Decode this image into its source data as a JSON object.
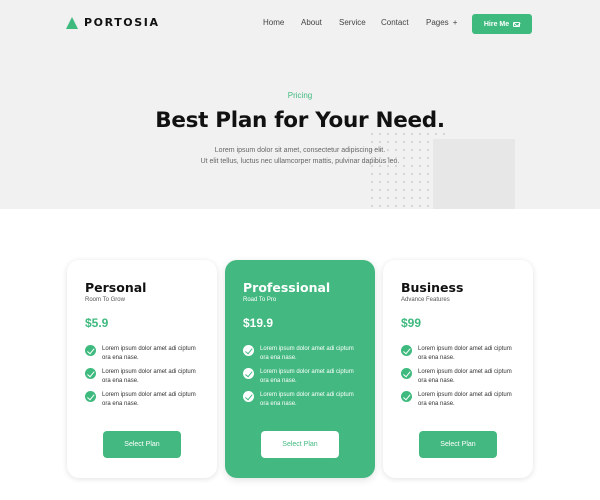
{
  "brand": {
    "name": "PORTOSIA",
    "logo_icon": "triangle-logo-icon",
    "accent": "#3fba7f"
  },
  "nav": {
    "items": [
      "Home",
      "About",
      "Service",
      "Contact",
      "Pages"
    ],
    "pages_suffix": "+",
    "cta_label": "Hire Me",
    "cta_icon": "mail-icon"
  },
  "hero": {
    "eyebrow": "Pricing",
    "title": "Best Plan for Your Need.",
    "subtitle_line1": "Lorem ipsum dolor sit amet, consectetur adipiscing elit.",
    "subtitle_line2": "Ut elit tellus, luctus nec ullamcorper mattis, pulvinar dapibus leo."
  },
  "plans": [
    {
      "name": "Personal",
      "tagline": "Room To Grow",
      "price": "$5.9",
      "featured": false,
      "features": [
        "Lorem ipsum dolor amet adi ciptum ora ena nase.",
        "Lorem ipsum dolor amet adi ciptum ora ena nase.",
        "Lorem ipsum dolor amet adi ciptum ora ena nase."
      ],
      "button_label": "Select Plan"
    },
    {
      "name": "Professional",
      "tagline": "Road To Pro",
      "price": "$19.9",
      "featured": true,
      "features": [
        "Lorem ipsum dolor amet adi ciptum ora ena nase.",
        "Lorem ipsum dolor amet adi ciptum ora ena nase.",
        "Lorem ipsum dolor amet adi ciptum ora ena nase."
      ],
      "button_label": "Select Plan"
    },
    {
      "name": "Business",
      "tagline": "Advance Features",
      "price": "$99",
      "featured": false,
      "features": [
        "Lorem ipsum dolor amet adi ciptum ora ena nase.",
        "Lorem ipsum dolor amet adi ciptum ora ena nase.",
        "Lorem ipsum dolor amet adi ciptum ora ena nase."
      ],
      "button_label": "Select Plan"
    }
  ],
  "colors": {
    "accent": "#3fba7f",
    "hero_bg": "#f2f1f2",
    "featured_card": "#43b981"
  }
}
